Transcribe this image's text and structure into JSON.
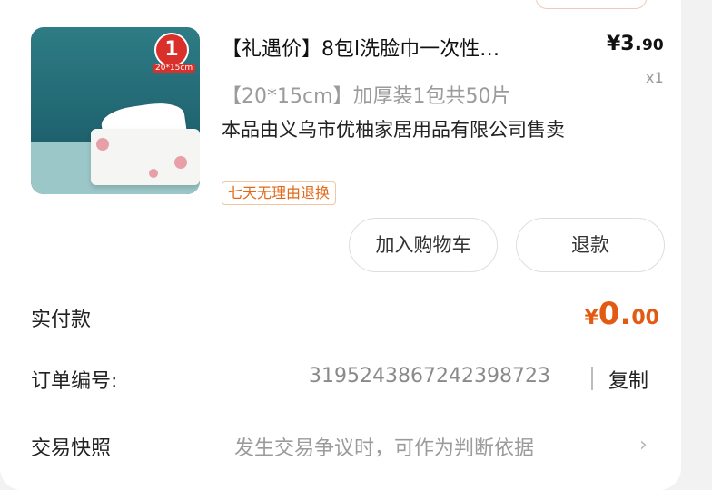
{
  "product": {
    "title": "【礼遇价】8包l洗脸巾一次性…",
    "price_main": "¥3.",
    "price_cents": "90",
    "quantity": "x1",
    "spec": "【20*15cm】加厚装1包共50片",
    "seller": "本品由义乌市优柚家居用品有限公司售卖",
    "return_policy": "七天无理由退换",
    "thumbnail_badge": "1",
    "thumbnail_badge_sub": "20*15cm"
  },
  "actions": {
    "add_to_cart": "加入购物车",
    "refund": "退款"
  },
  "payment": {
    "label": "实付款",
    "yen": "¥",
    "amount_main": "0.",
    "amount_cents": "00"
  },
  "order": {
    "label": "订单编号:",
    "number": "3195243867242398723",
    "copy": "复制"
  },
  "snapshot": {
    "label": "交易快照",
    "hint": "发生交易争议时，可作为判断依据",
    "chevron": "›"
  },
  "colors": {
    "accent_orange": "#e35a12",
    "tag_orange": "#e06a1a",
    "badge_red": "#d9302b"
  }
}
